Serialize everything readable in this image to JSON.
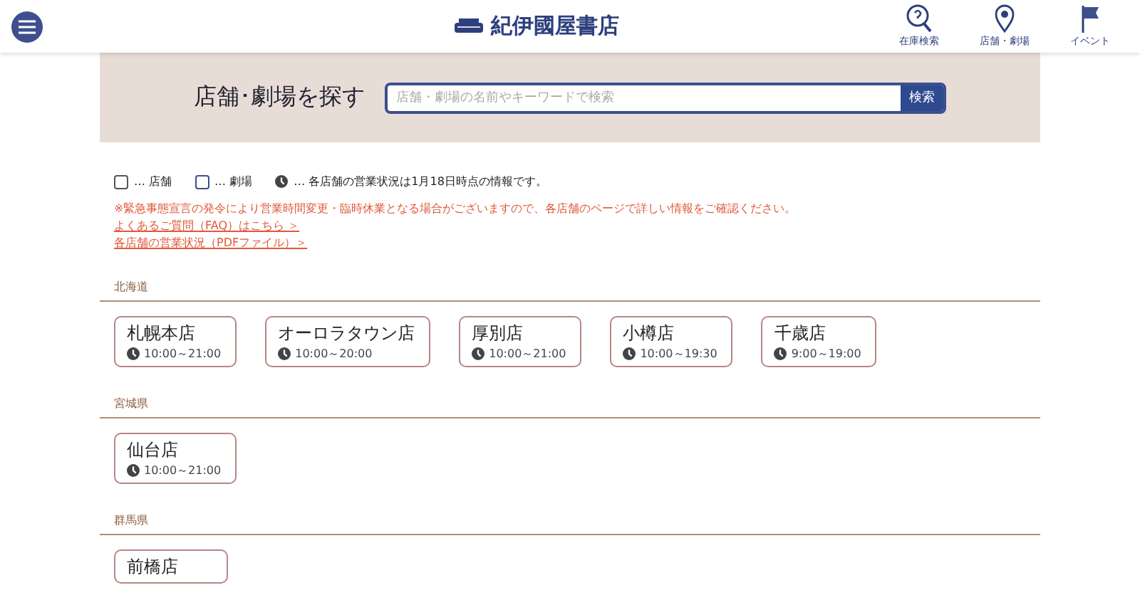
{
  "header": {
    "logo_text": "紀伊國屋書店",
    "nav": [
      {
        "label": "在庫検索"
      },
      {
        "label": "店舗・劇場"
      },
      {
        "label": "イベント"
      }
    ]
  },
  "search": {
    "title": "店舗･劇場を探す",
    "placeholder": "店舗・劇場の名前やキーワードで検索",
    "button": "検索"
  },
  "legend": [
    {
      "kind": "store",
      "label": "… 店舗"
    },
    {
      "kind": "theater",
      "label": "… 劇場"
    },
    {
      "kind": "hours",
      "label": "… 各店舗の営業状況は1月18日時点の情報です。"
    }
  ],
  "notice": "※緊急事態宣言の発令により営業時間変更・臨時休業となる場合がございますので、各店舗のページで詳しい情報をご確認ください。",
  "links": [
    "よくあるご質問（FAQ）はこちら ＞",
    "各店舗の営業状況（PDFファイル）＞"
  ],
  "regions": [
    {
      "name": "北海道",
      "stores": [
        {
          "name": "札幌本店",
          "hours": "10:00～21:00"
        },
        {
          "name": "オーロラタウン店",
          "hours": "10:00～20:00"
        },
        {
          "name": "厚別店",
          "hours": "10:00～21:00"
        },
        {
          "name": "小樽店",
          "hours": "10:00～19:30"
        },
        {
          "name": "千歳店",
          "hours": "9:00～19:00"
        }
      ]
    },
    {
      "name": "宮城県",
      "stores": [
        {
          "name": "仙台店",
          "hours": "10:00～21:00"
        }
      ]
    },
    {
      "name": "群馬県",
      "stores": [
        {
          "name": "前橋店"
        }
      ]
    }
  ]
}
